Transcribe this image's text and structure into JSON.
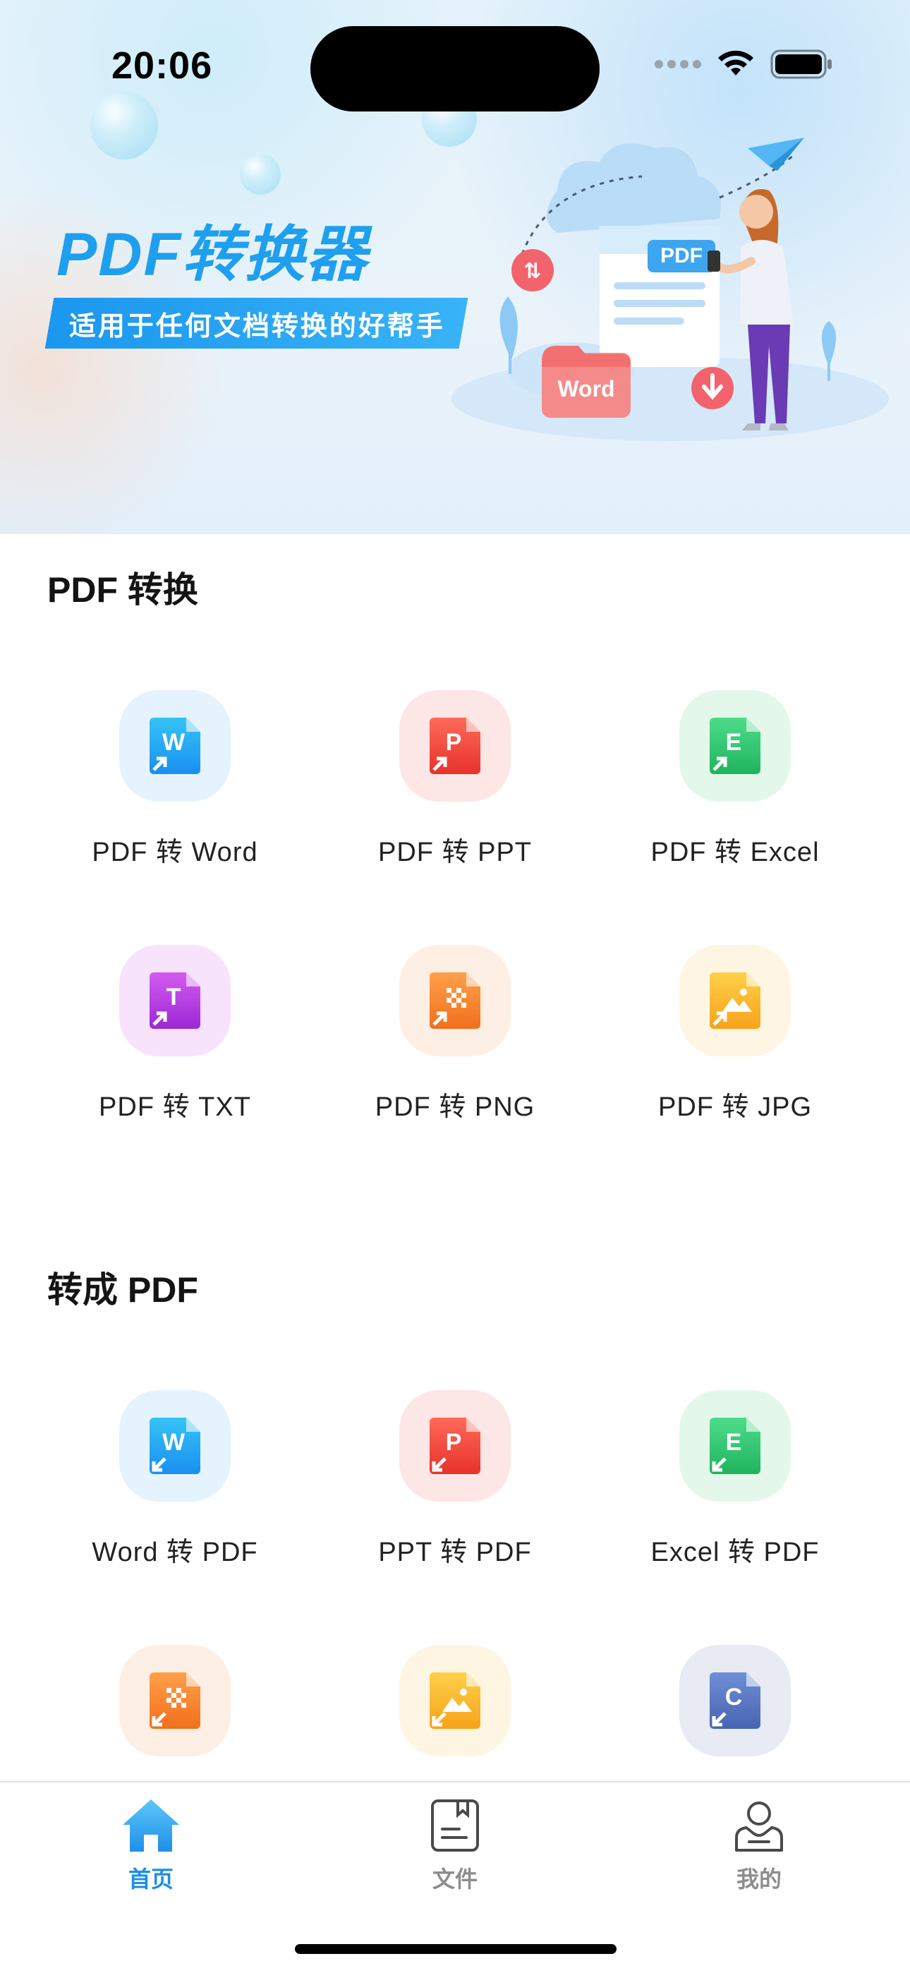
{
  "status_bar": {
    "time": "20:06"
  },
  "hero": {
    "title": "PDF转换器",
    "subtitle": "适用于任何文档转换的好帮手",
    "illustration": {
      "doc_badge": "PDF",
      "folder_label": "Word"
    }
  },
  "sections": [
    {
      "title": "PDF 转换",
      "items": [
        {
          "label": "PDF 转 Word",
          "letter": "W",
          "icon": "word-icon",
          "bg": "#e4f3fd",
          "from": "#35c4f6",
          "to": "#1a8ff0"
        },
        {
          "label": "PDF 转 PPT",
          "letter": "P",
          "icon": "ppt-icon",
          "bg": "#fde6e6",
          "from": "#ff6a5a",
          "to": "#e8322a"
        },
        {
          "label": "PDF 转 Excel",
          "letter": "E",
          "icon": "excel-icon",
          "bg": "#e3f8ea",
          "from": "#4edc8b",
          "to": "#1fb35d"
        },
        {
          "label": "PDF 转 TXT",
          "letter": "T",
          "icon": "txt-icon",
          "bg": "#f7e3fb",
          "from": "#d35cf0",
          "to": "#9c27d6"
        },
        {
          "label": "PDF 转 PNG",
          "letter": "",
          "icon": "png-icon",
          "bg": "#fdefe4",
          "from": "#ffa04a",
          "to": "#f26f1c"
        },
        {
          "label": "PDF 转 JPG",
          "letter": "",
          "icon": "jpg-icon",
          "bg": "#fef6e3",
          "from": "#ffd04a",
          "to": "#f7a21a"
        }
      ]
    },
    {
      "title": "转成 PDF",
      "items": [
        {
          "label": "Word 转 PDF",
          "letter": "W",
          "icon": "word-icon",
          "bg": "#e4f3fd",
          "from": "#35c4f6",
          "to": "#1a8ff0"
        },
        {
          "label": "PPT 转 PDF",
          "letter": "P",
          "icon": "ppt-icon",
          "bg": "#fde6e6",
          "from": "#ff6a5a",
          "to": "#e8322a"
        },
        {
          "label": "Excel 转 PDF",
          "letter": "E",
          "icon": "excel-icon",
          "bg": "#e3f8ea",
          "from": "#4edc8b",
          "to": "#1fb35d"
        },
        {
          "label": "",
          "letter": "",
          "icon": "png-icon",
          "bg": "#fdefe4",
          "from": "#ffa04a",
          "to": "#f26f1c"
        },
        {
          "label": "",
          "letter": "",
          "icon": "jpg-icon",
          "bg": "#fef6e3",
          "from": "#ffd04a",
          "to": "#f7a21a"
        },
        {
          "label": "",
          "letter": "C",
          "icon": "c-file-icon",
          "bg": "#e8ebf3",
          "from": "#6f8fd6",
          "to": "#4764b0"
        }
      ]
    }
  ],
  "tabbar": {
    "items": [
      {
        "label": "首页",
        "icon": "home-icon",
        "active": true
      },
      {
        "label": "文件",
        "icon": "file-icon",
        "active": false
      },
      {
        "label": "我的",
        "icon": "profile-icon",
        "active": false
      }
    ],
    "accent": "#1c8ee6"
  }
}
